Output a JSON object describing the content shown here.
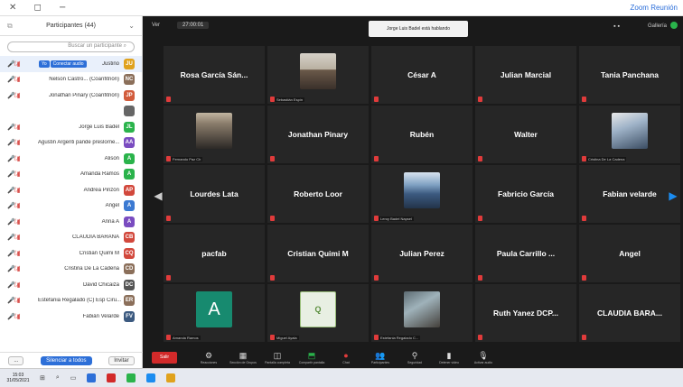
{
  "window": {
    "title_right": "Zoom Reunión"
  },
  "participants_panel": {
    "title": "Participantes (44)",
    "search_placeholder": "Buscar un participante",
    "tags": {
      "host": "Yo",
      "waiting": "Conectar audio"
    },
    "items": [
      {
        "name": "Justino",
        "avatar_letter": "JU",
        "avatar_color": "#e0a21d",
        "highlight": true
      },
      {
        "name": "Nelson Castro... (Coanfitrión)",
        "avatar_letter": "NC",
        "avatar_color": "#8b6f5a"
      },
      {
        "name": "Jonathan Pinary (Coanfitrión)",
        "avatar_letter": "JP",
        "avatar_color": "#d25c3c"
      },
      {
        "name": "",
        "avatar_letter": "",
        "avatar_color": "#666666"
      },
      {
        "name": "Jorge Luis Badel",
        "avatar_letter": "JL",
        "avatar_color": "#2ab34b"
      },
      {
        "name": "Agustin Argenti pande preslorne...",
        "avatar_letter": "AA",
        "avatar_color": "#7a4cc0"
      },
      {
        "name": "Alison",
        "avatar_letter": "A",
        "avatar_color": "#2ab34b"
      },
      {
        "name": "Amanda Ramos",
        "avatar_letter": "A",
        "avatar_color": "#2ab34b"
      },
      {
        "name": "Andrea Pinzón",
        "avatar_letter": "AP",
        "avatar_color": "#d2483c"
      },
      {
        "name": "Angel",
        "avatar_letter": "A",
        "avatar_color": "#3c7ad2"
      },
      {
        "name": "Anna A",
        "avatar_letter": "A",
        "avatar_color": "#7a4cc0"
      },
      {
        "name": "CLAUDIA BARAÑA",
        "avatar_letter": "CB",
        "avatar_color": "#d2483c"
      },
      {
        "name": "Cristian Quimi M",
        "avatar_letter": "CQ",
        "avatar_color": "#d2483c"
      },
      {
        "name": "Cristina De La Cadena",
        "avatar_letter": "CD",
        "avatar_color": "#8b6f5a"
      },
      {
        "name": "David Chicaiza",
        "avatar_letter": "DC",
        "avatar_color": "#555555"
      },
      {
        "name": "Estefania Regalado (C) Esp Ciru...",
        "avatar_letter": "ER",
        "avatar_color": "#8b6f5a"
      },
      {
        "name": "Fabián Velarde",
        "avatar_letter": "FV",
        "avatar_color": "#3c5a80"
      }
    ],
    "footer": {
      "invite": "Invitar",
      "mute_all": "Silenciar a todos",
      "more": "..."
    }
  },
  "top_bar": {
    "view_label": "Ver",
    "recording_label": "27:00:01",
    "spotlight_text": "Jorge Luis Badel está hablando",
    "camera_label": "Gallería"
  },
  "tiles": [
    {
      "name": "Rosa García Sán...",
      "caption": "",
      "photo": ""
    },
    {
      "name": "",
      "caption": "Sebastián Espín",
      "photo": "ph1"
    },
    {
      "name": "César A",
      "caption": "",
      "photo": ""
    },
    {
      "name": "Julian Marcial",
      "caption": "",
      "photo": ""
    },
    {
      "name": "Tania Panchana",
      "caption": "",
      "photo": ""
    },
    {
      "name": "",
      "caption": "Fernando Paz Ch",
      "photo": "ph2"
    },
    {
      "name": "Jonathan Pinary",
      "caption": "",
      "photo": ""
    },
    {
      "name": "Rubén",
      "caption": "",
      "photo": ""
    },
    {
      "name": "Walter",
      "caption": "",
      "photo": ""
    },
    {
      "name": "",
      "caption": "Cristina De La Cadena",
      "photo": "ph3"
    },
    {
      "name": "Lourdes Lata",
      "caption": "",
      "photo": ""
    },
    {
      "name": "Roberto Loor",
      "caption": "",
      "photo": ""
    },
    {
      "name": "",
      "caption": "Leroy Badel Napsel",
      "photo": "ph4"
    },
    {
      "name": "Fabricio García",
      "caption": "",
      "photo": ""
    },
    {
      "name": "Fabian velarde",
      "caption": "",
      "photo": ""
    },
    {
      "name": "pacfab",
      "caption": "",
      "photo": ""
    },
    {
      "name": "Cristian Quimi M",
      "caption": "",
      "photo": ""
    },
    {
      "name": "Julian Perez",
      "caption": "",
      "photo": ""
    },
    {
      "name": "Paula Carrillo ...",
      "caption": "",
      "photo": ""
    },
    {
      "name": "Angel",
      "caption": "",
      "photo": ""
    },
    {
      "name": "",
      "caption": "Amanda Ramos",
      "photo": "ph7",
      "letter": "A"
    },
    {
      "name": "",
      "caption": "Miguel Ayala",
      "photo": "ph6",
      "letter": "Q"
    },
    {
      "name": "",
      "caption": "Estefania Regalado C...",
      "photo": "ph5"
    },
    {
      "name": "Ruth Yanez DCP...",
      "caption": "",
      "photo": ""
    },
    {
      "name": "CLAUDIA BARA...",
      "caption": "",
      "photo": ""
    }
  ],
  "toolbar": {
    "leave": "Salir",
    "buttons": [
      {
        "icon": "⚙",
        "label": "Reacciones",
        "color": ""
      },
      {
        "icon": "▦",
        "label": "Sección de Grupos",
        "color": ""
      },
      {
        "icon": "◫",
        "label": "Pantalla completa",
        "color": ""
      },
      {
        "icon": "⬒",
        "label": "Compartir pantalla",
        "color": "green"
      },
      {
        "icon": "●",
        "label": "Chat",
        "color": "red"
      },
      {
        "icon": "👥",
        "label": "Participantes",
        "color": ""
      },
      {
        "icon": "⚲",
        "label": "Seguridad",
        "color": ""
      },
      {
        "icon": "▮",
        "label": "Detener video",
        "color": ""
      },
      {
        "icon": "🎙",
        "label": "Activar audio",
        "color": ""
      }
    ]
  },
  "taskbar": {
    "time": "15:03",
    "date": "31/05/2021"
  }
}
